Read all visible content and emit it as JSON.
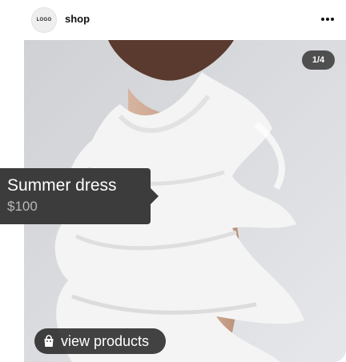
{
  "header": {
    "logo_text": "LOGO",
    "shop_name": "shop",
    "more_icon": "more-horizontal-icon"
  },
  "photo": {
    "counter": "1/4",
    "subject": "product-photo"
  },
  "product_tag": {
    "name": "Summer dress",
    "price": "$100"
  },
  "view_products": {
    "label": "view products",
    "icon": "shopping-bag-icon"
  },
  "colors": {
    "tag_background": "#3c3c3c",
    "button_background": "#222222",
    "photo_background": "#dcdde0"
  }
}
